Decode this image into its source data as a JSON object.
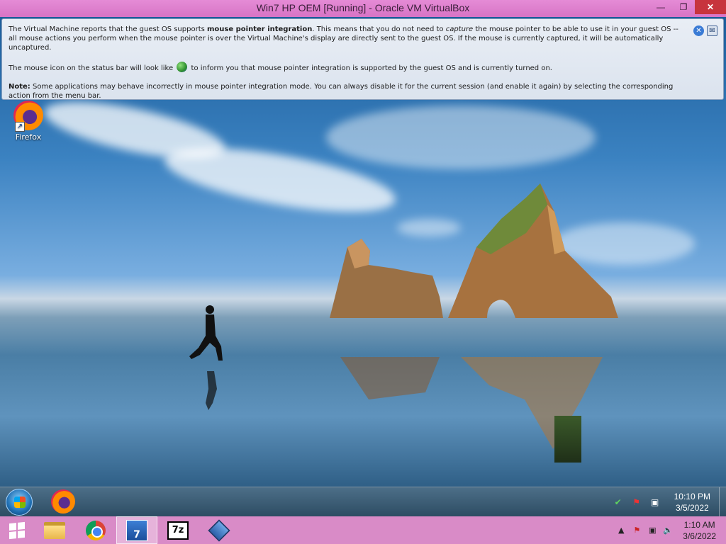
{
  "window": {
    "title": "Win7 HP OEM [Running] - Oracle VM VirtualBox",
    "minimize_glyph": "—",
    "restore_glyph": "❐",
    "close_glyph": "✕"
  },
  "banner": {
    "p1_a": "The Virtual Machine reports that the guest OS supports ",
    "p1_b": "mouse pointer integration",
    "p1_c": ". This means that you do not need to ",
    "p1_d": "capture",
    "p1_e": " the mouse pointer to be able to use it in your guest OS -- all mouse actions you perform when the mouse pointer is over the Virtual Machine's display are directly sent to the guest OS. If the mouse is currently captured, it will be automatically uncaptured.",
    "p2_a": "The mouse icon on the status bar will look like",
    "p2_b": "to inform you that mouse pointer integration is supported by the guest OS and is currently turned on.",
    "p3_a": "Note:",
    "p3_b": " Some applications may behave incorrectly in mouse pointer integration mode. You can always disable it for the current session (and enable it again) by selecting the corresponding action from the menu bar.",
    "close_glyph": "✕",
    "msg_glyph": "✉"
  },
  "desktop": {
    "icons": [
      {
        "label": "Firefox",
        "icon": "firefox-icon"
      }
    ]
  },
  "guest_taskbar": {
    "pinned": [
      "firefox-icon"
    ],
    "clock_time": "10:10 PM",
    "clock_date": "3/5/2022"
  },
  "host_taskbar": {
    "apps": [
      "file-explorer-icon",
      "chrome-icon",
      "windows7-usb-tool-icon",
      "7zip-icon",
      "virtualbox-icon"
    ],
    "sevenzip_label": "7z",
    "w7_label": "7",
    "tray_up": "▲",
    "clock_time": "1:10 AM",
    "clock_date": "3/6/2022"
  }
}
